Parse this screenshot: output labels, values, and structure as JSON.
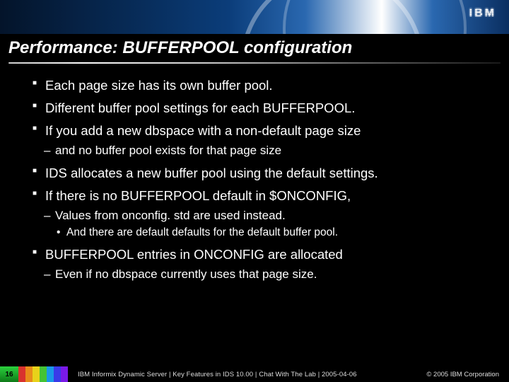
{
  "brand": "IBM",
  "title": "Performance: BUFFERPOOL configuration",
  "bullets": {
    "b1": "Each page size has its own buffer pool.",
    "b2": "Different buffer pool settings for each BUFFERPOOL.",
    "b3": "If you add a new dbspace with a non-default page size",
    "b3a": "and no buffer pool exists for that page size",
    "b4": "IDS allocates a new buffer pool using the default settings.",
    "b5": "If there is no BUFFERPOOL default in $ONCONFIG,",
    "b5a": "Values from onconfig. std are used instead.",
    "b5b": "And there are default defaults for the default buffer pool.",
    "b6": "BUFFERPOOL entries in ONCONFIG are allocated",
    "b6a": "Even if no dbspace currently uses that page size."
  },
  "footer": {
    "page": "16",
    "text": "IBM Informix Dynamic Server | Key Features in IDS 10.00 | Chat With The Lab | 2005-04-06",
    "copyright": "© 2005 IBM Corporation"
  }
}
